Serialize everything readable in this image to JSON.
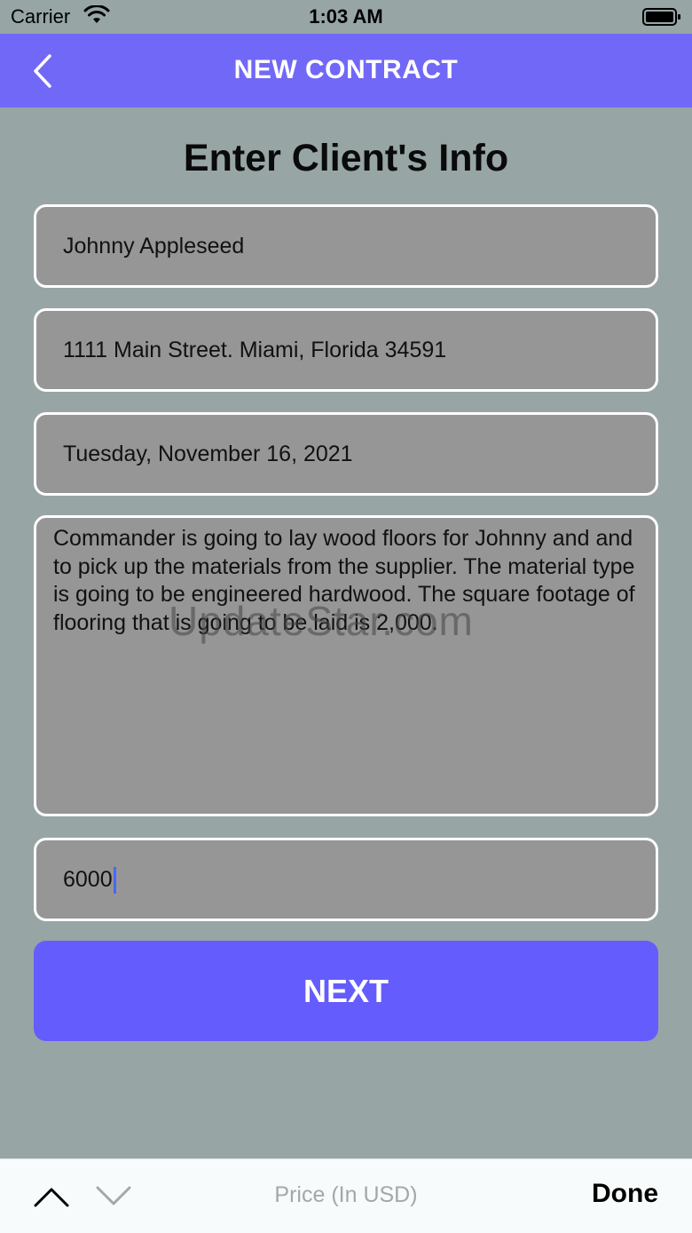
{
  "status": {
    "carrier": "Carrier",
    "time": "1:03 AM"
  },
  "nav": {
    "title": "NEW CONTRACT"
  },
  "heading": "Enter Client's Info",
  "fields": {
    "name": "Johnny Appleseed",
    "address": "1111 Main Street. Miami, Florida 34591",
    "date": "Tuesday, November 16, 2021",
    "description": "Commander is going to lay wood floors for Johnny and and to pick up the materials from the supplier.  The material type is going to be engineered hardwood.  The square footage of flooring that is going to be laid is 2,000.",
    "price": "6000"
  },
  "watermark": "UpdateStar.com",
  "next_label": "NEXT",
  "keyboard_toolbar": {
    "label": "Price (In USD)",
    "done": "Done"
  },
  "colors": {
    "accent": "#7168f7",
    "button": "#655cfd",
    "background": "#97a5a5",
    "field": "#969696",
    "caret": "#4a66ff"
  },
  "icons": {
    "back": "chevron-left-icon",
    "up": "chevron-up-icon",
    "down": "chevron-down-icon"
  }
}
